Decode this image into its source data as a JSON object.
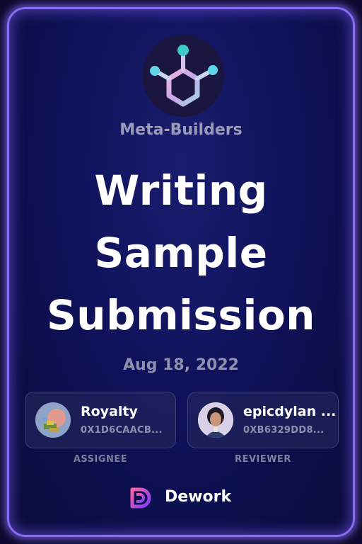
{
  "organization": {
    "name": "Meta-Builders",
    "logo": "hexagon-molecule-logo-icon"
  },
  "task": {
    "title_lines": [
      "Writing",
      "Sample",
      "Submission"
    ],
    "date": "Aug 18, 2022"
  },
  "assignee": {
    "name": "Royalty",
    "address": "0X1D6CAACB...",
    "role_label": "ASSIGNEE",
    "avatar": "pixel-art-avatar-icon"
  },
  "reviewer": {
    "name": "epicdylan ...",
    "address": "0XB6329DD8...",
    "role_label": "REVIEWER",
    "avatar": "portrait-avatar-icon"
  },
  "brand": {
    "name": "Dework",
    "icon": "dework-logo-icon"
  },
  "colors": {
    "border_glow": "#8a6bf5",
    "background": "#0f125a",
    "text_primary": "#ffffff",
    "text_muted": "#8f90ad"
  }
}
